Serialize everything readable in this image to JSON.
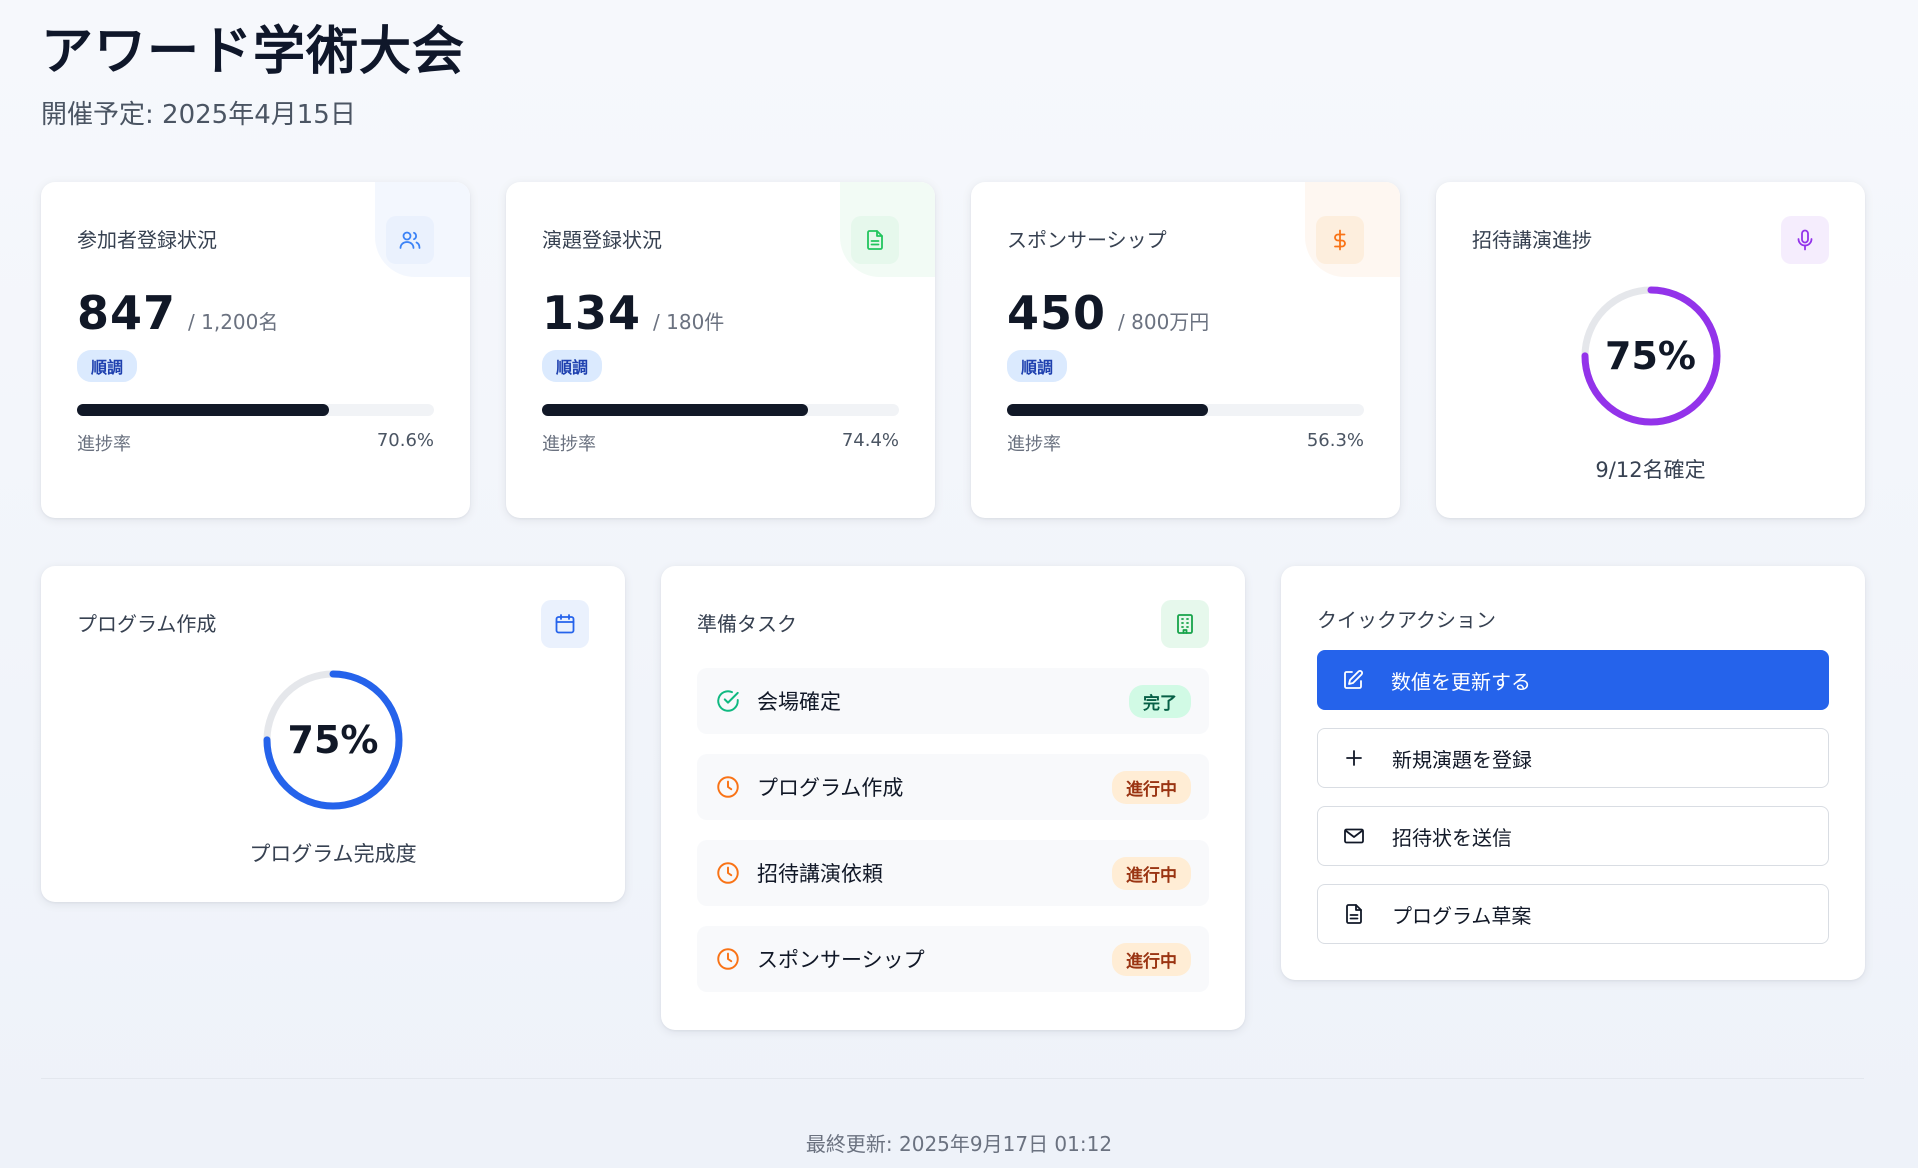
{
  "header": {
    "title": "アワード学術大会",
    "subtitle": "開催予定: 2025年4月15日"
  },
  "stats": [
    {
      "label": "参加者登録状況",
      "value": "847",
      "total": "/ 1,200名",
      "badge": "順調",
      "progress_label": "進捗率",
      "progress_text": "70.6%",
      "progress": 0.706,
      "icon": "users-icon",
      "accent": "#3b82f6"
    },
    {
      "label": "演題登録状況",
      "value": "134",
      "total": "/ 180件",
      "badge": "順調",
      "progress_label": "進捗率",
      "progress_text": "74.4%",
      "progress": 0.744,
      "icon": "document-icon",
      "accent": "#22c55e"
    },
    {
      "label": "スポンサーシップ",
      "value": "450",
      "total": "/ 800万円",
      "badge": "順調",
      "progress_label": "進捗率",
      "progress_text": "56.3%",
      "progress": 0.563,
      "icon": "dollar-icon",
      "accent": "#f97316"
    }
  ],
  "invited": {
    "label": "招待講演進捗",
    "percent_text": "75%",
    "progress": 0.75,
    "caption": "9/12名確定",
    "icon": "microphone-icon",
    "accent": "#9333ea"
  },
  "program": {
    "label": "プログラム作成",
    "percent_text": "75%",
    "progress": 0.75,
    "caption": "プログラム完成度",
    "icon": "calendar-icon",
    "accent": "#2563eb"
  },
  "tasks": {
    "label": "準備タスク",
    "icon": "building-icon",
    "items": [
      {
        "label": "会場確定",
        "status": "完了",
        "state": "done"
      },
      {
        "label": "プログラム作成",
        "status": "進行中",
        "state": "progress"
      },
      {
        "label": "招待講演依頼",
        "status": "進行中",
        "state": "progress"
      },
      {
        "label": "スポンサーシップ",
        "status": "進行中",
        "state": "progress"
      }
    ]
  },
  "quick_actions": {
    "label": "クイックアクション",
    "buttons": [
      {
        "label": "数値を更新する",
        "icon": "edit-icon",
        "primary": true
      },
      {
        "label": "新規演題を登録",
        "icon": "plus-icon",
        "primary": false
      },
      {
        "label": "招待状を送信",
        "icon": "mail-icon",
        "primary": false
      },
      {
        "label": "プログラム草案",
        "icon": "file-icon",
        "primary": false
      }
    ]
  },
  "footer": {
    "last_updated": "最終更新: 2025年9月17日 01:12"
  },
  "colors": {
    "primary": "#2563eb",
    "done_green": "#10b981",
    "progress_orange": "#f97316"
  }
}
